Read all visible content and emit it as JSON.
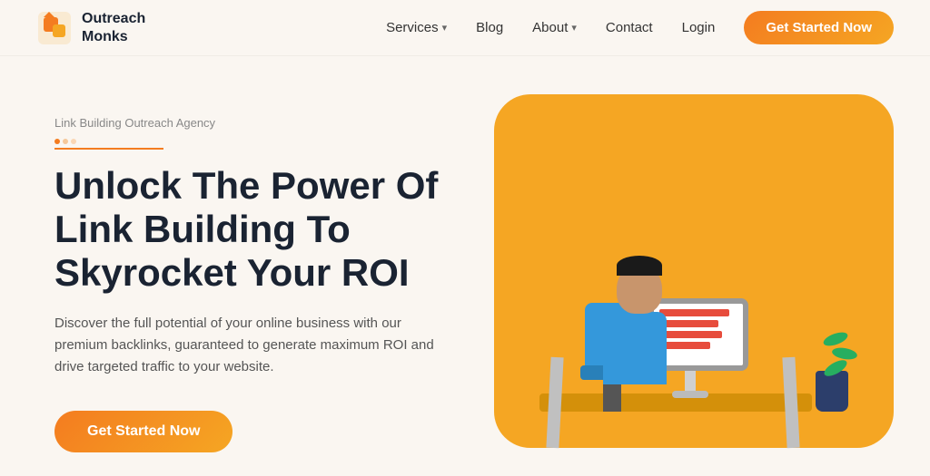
{
  "brand": {
    "name_line1": "Outreach",
    "name_line2": "Monks"
  },
  "nav": {
    "links": [
      {
        "label": "Services",
        "has_dropdown": true
      },
      {
        "label": "Blog",
        "has_dropdown": false
      },
      {
        "label": "About",
        "has_dropdown": true
      },
      {
        "label": "Contact",
        "has_dropdown": false
      },
      {
        "label": "Login",
        "has_dropdown": false
      }
    ],
    "cta_label": "Get Started Now"
  },
  "hero": {
    "tagline": "Link Building Outreach Agency",
    "title_line1": "Unlock The Power Of",
    "title_line2": "Link Building To",
    "title_line3": "Skyrocket Your ROI",
    "description": "Discover the full potential of your online business with our premium backlinks, guaranteed to generate maximum ROI and drive targeted traffic to your website.",
    "cta_label": "Get Started Now"
  }
}
